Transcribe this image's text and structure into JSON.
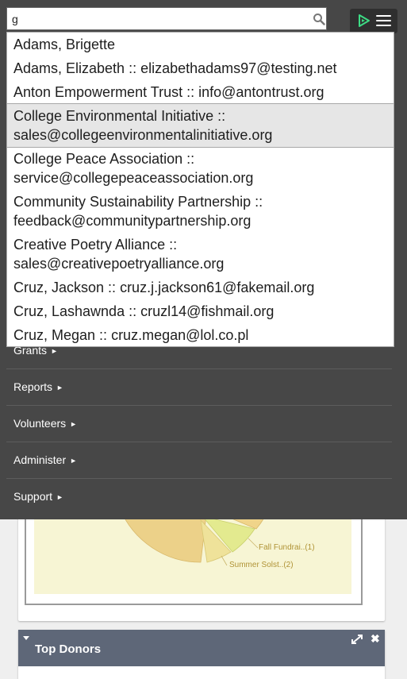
{
  "search": {
    "value": "g",
    "placeholder": ""
  },
  "autocomplete": [
    {
      "name": "Adams, Brigette",
      "email": ""
    },
    {
      "name": "Adams, Elizabeth",
      "email": "elizabethadams97@testing.net"
    },
    {
      "name": "Anton Empowerment Trust",
      "email": "info@antontrust.org"
    },
    {
      "name": "College Environmental Initiative",
      "email": "sales@collegeenvironmentalinitiative.org",
      "active": true
    },
    {
      "name": "College Peace Association",
      "email": "service@collegepeaceassociation.org"
    },
    {
      "name": "Community Sustainability Partnership",
      "email": "feedback@communitypartnership.org"
    },
    {
      "name": "Creative Poetry Alliance",
      "email": "sales@creativepoetryalliance.org"
    },
    {
      "name": "Cruz, Jackson",
      "email": "cruz.j.jackson61@fakemail.org"
    },
    {
      "name": "Cruz, Lashawnda",
      "email": "cruzl14@fishmail.org"
    },
    {
      "name": "Cruz, Megan",
      "email": "cruz.megan@lol.co.pl"
    }
  ],
  "nav": {
    "items": [
      {
        "label": "Grants",
        "arrow": "►"
      },
      {
        "label": "Reports",
        "arrow": "►"
      },
      {
        "label": "Volunteers",
        "arrow": "►"
      },
      {
        "label": "Administer",
        "arrow": "►"
      },
      {
        "label": "Support",
        "arrow": "►"
      }
    ]
  },
  "chart": {
    "labels": [
      "Fall Fundrai..(1)",
      "Summer Solst..(2)"
    ]
  },
  "dashlet": {
    "title": "Top Donors"
  },
  "colors": {
    "nav_bg": "#474747",
    "dashlet_header": "#5e6778",
    "logo_accent": "#3ddc84"
  },
  "icons": {
    "search": "search-icon",
    "menu": "hamburger-icon",
    "logo": "civicrm-logo-icon",
    "expand": "expand-icon",
    "close": "close-icon"
  }
}
